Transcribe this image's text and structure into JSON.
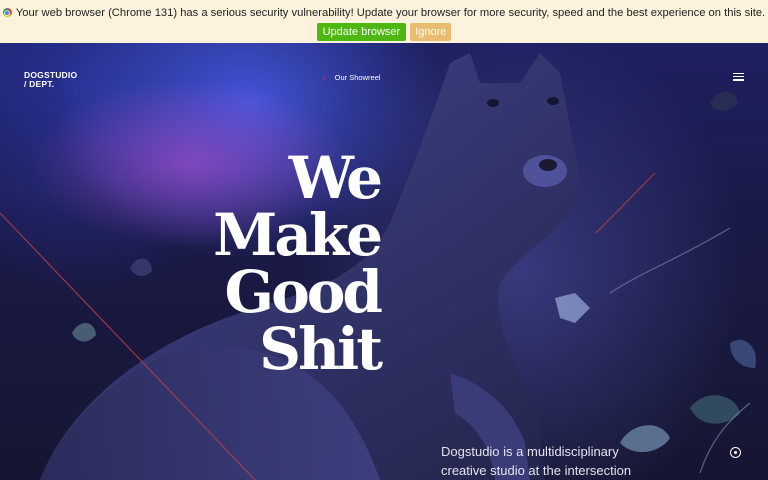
{
  "banner": {
    "message": "Your web browser (Chrome 131) has a serious security vulnerability! Update your browser for more security, speed and the best experience on this site.",
    "update_label": "Update browser",
    "ignore_label": "Ignore"
  },
  "nav": {
    "logo_line1": "DOGSTUDIO",
    "logo_line2": "/ DEPT.",
    "showreel_label": "Our Showreel",
    "menu_icon": "hamburger-icon"
  },
  "hero": {
    "headline": [
      "We",
      "Make",
      "Good",
      "Shit"
    ],
    "intro": "Dogstudio is a multidisciplinary creative studio at the intersection"
  },
  "colors": {
    "banner_bg": "#fdf3dd",
    "update_button": "#4cb811",
    "ignore_button": "#e8bd6f",
    "accent_red": "#e83a4a"
  }
}
